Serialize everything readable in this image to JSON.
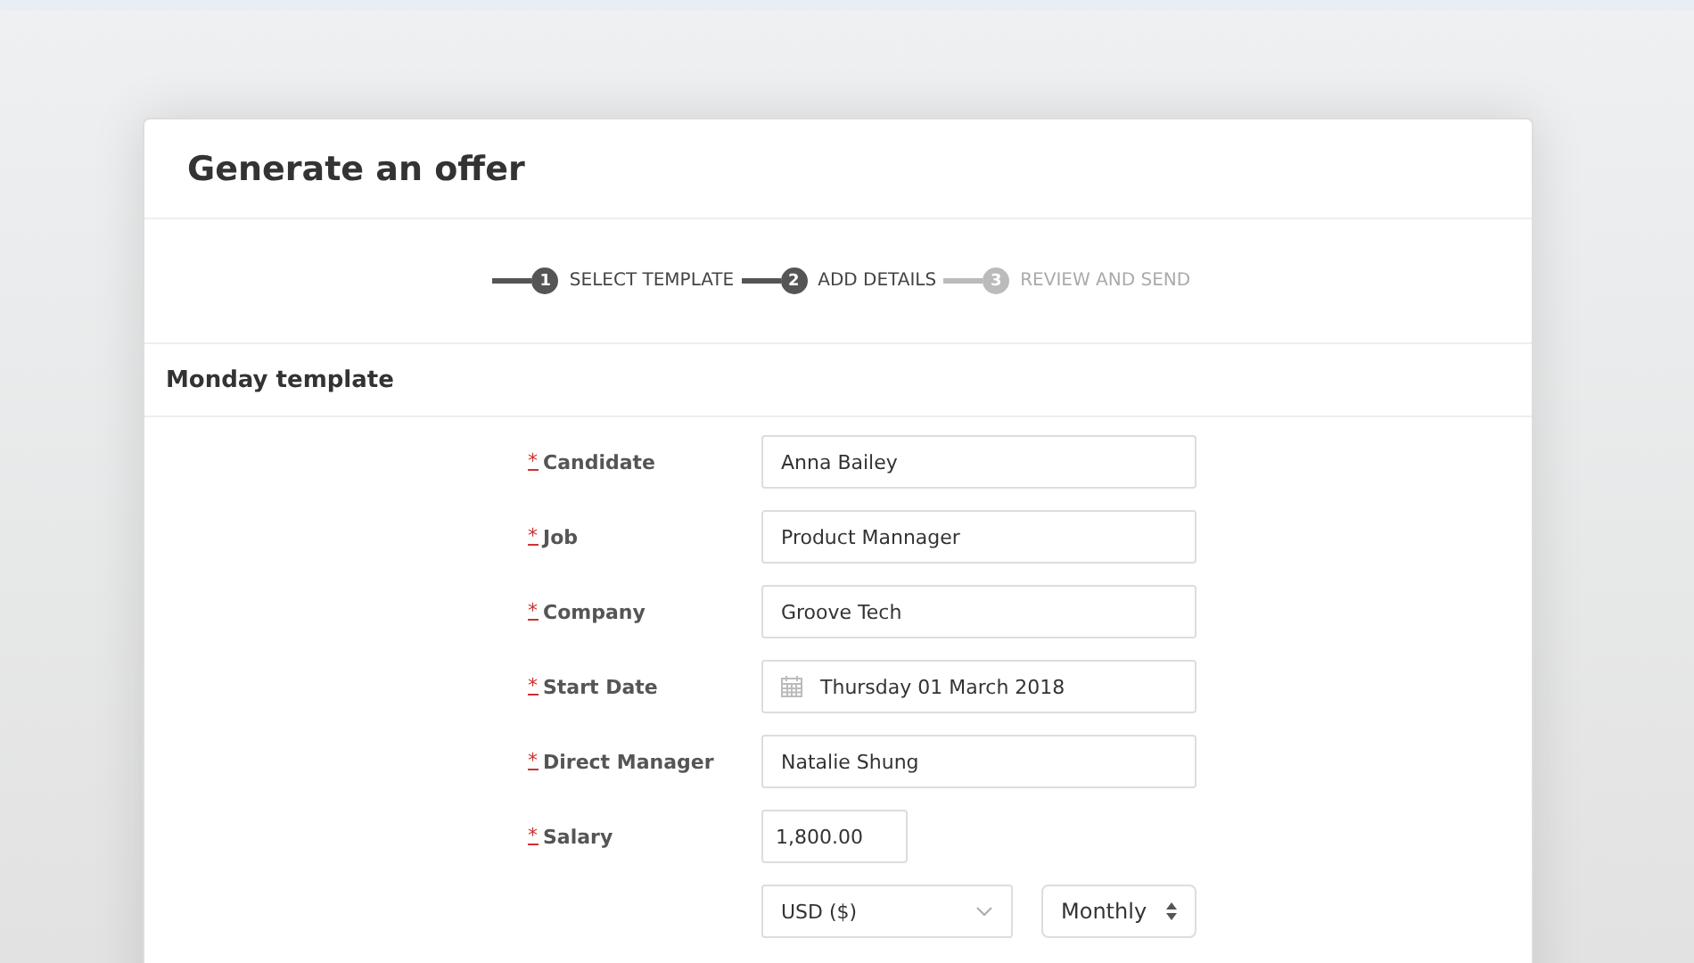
{
  "dialog": {
    "title": "Generate an offer"
  },
  "steps": [
    {
      "number": "1",
      "label": "SELECT TEMPLATE",
      "done": true
    },
    {
      "number": "2",
      "label": "ADD DETAILS",
      "done": true
    },
    {
      "number": "3",
      "label": "REVIEW AND SEND",
      "done": false
    }
  ],
  "section": {
    "title": "Monday template"
  },
  "fields": [
    {
      "mark": "*",
      "label": "Candidate",
      "kind": "text",
      "value": "Anna Bailey"
    },
    {
      "mark": "*",
      "label": "Job",
      "kind": "text",
      "value": "Product Mannager"
    },
    {
      "mark": "*",
      "label": "Company",
      "kind": "text",
      "value": "Groove Tech"
    },
    {
      "mark": "*",
      "label": "Start Date",
      "kind": "date",
      "value": "Thursday 01 March 2018"
    },
    {
      "mark": "*",
      "label": "Direct Manager",
      "kind": "text",
      "value": "Natalie Shung"
    },
    {
      "mark": "*",
      "label": "Salary",
      "kind": "short",
      "value": "1,800.00"
    }
  ],
  "selects": [
    {
      "kind": "dropdown",
      "value": "USD ($)"
    },
    {
      "kind": "stepper",
      "value": "Monthly"
    }
  ]
}
